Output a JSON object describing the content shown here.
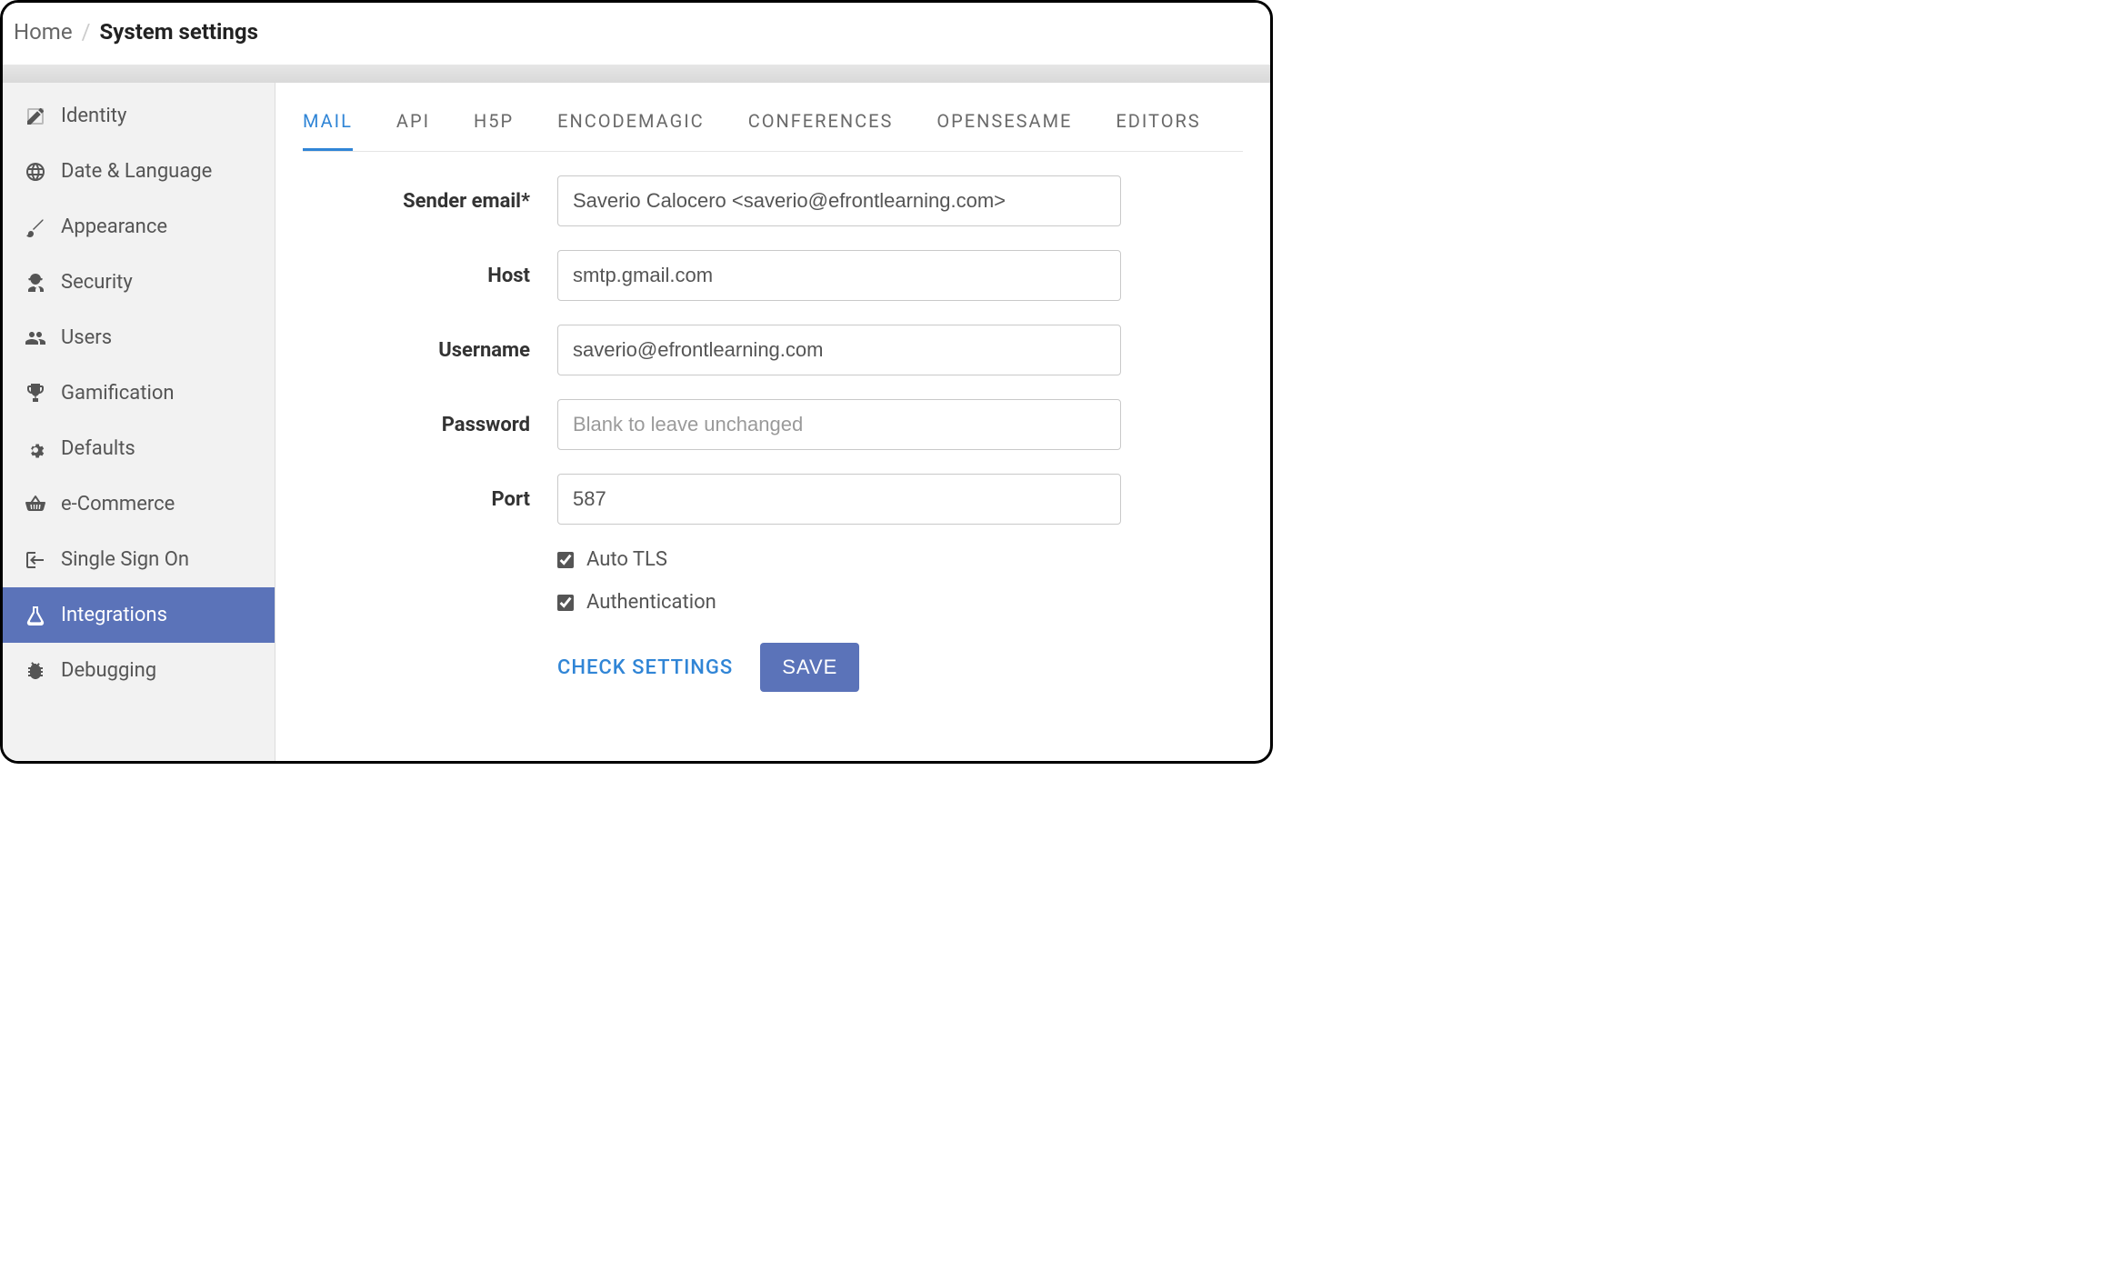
{
  "breadcrumb": {
    "home": "Home",
    "sep": "/",
    "current": "System settings"
  },
  "sidebar": {
    "items": [
      {
        "label": "Identity",
        "icon": "edit-square-icon"
      },
      {
        "label": "Date & Language",
        "icon": "globe-icon"
      },
      {
        "label": "Appearance",
        "icon": "brush-icon"
      },
      {
        "label": "Security",
        "icon": "agent-icon"
      },
      {
        "label": "Users",
        "icon": "users-icon"
      },
      {
        "label": "Gamification",
        "icon": "trophy-icon"
      },
      {
        "label": "Defaults",
        "icon": "gears-icon"
      },
      {
        "label": "e-Commerce",
        "icon": "basket-icon"
      },
      {
        "label": "Single Sign On",
        "icon": "signin-icon"
      },
      {
        "label": "Integrations",
        "icon": "flask-icon",
        "active": true
      },
      {
        "label": "Debugging",
        "icon": "bug-icon"
      }
    ]
  },
  "tabs": [
    "MAIL",
    "API",
    "H5P",
    "ENCODEMAGIC",
    "CONFERENCES",
    "OPENSESAME",
    "EDITORS"
  ],
  "active_tab": 0,
  "form": {
    "sender_email": {
      "label": "Sender email*",
      "value": "Saverio Calocero <saverio@efrontlearning.com>"
    },
    "host": {
      "label": "Host",
      "value": "smtp.gmail.com"
    },
    "username": {
      "label": "Username",
      "value": "saverio@efrontlearning.com"
    },
    "password": {
      "label": "Password",
      "value": "",
      "placeholder": "Blank to leave unchanged"
    },
    "port": {
      "label": "Port",
      "value": "587"
    },
    "auto_tls": {
      "label": "Auto TLS",
      "checked": true
    },
    "authentication": {
      "label": "Authentication",
      "checked": true
    },
    "check_settings_label": "CHECK SETTINGS",
    "save_label": "SAVE"
  }
}
